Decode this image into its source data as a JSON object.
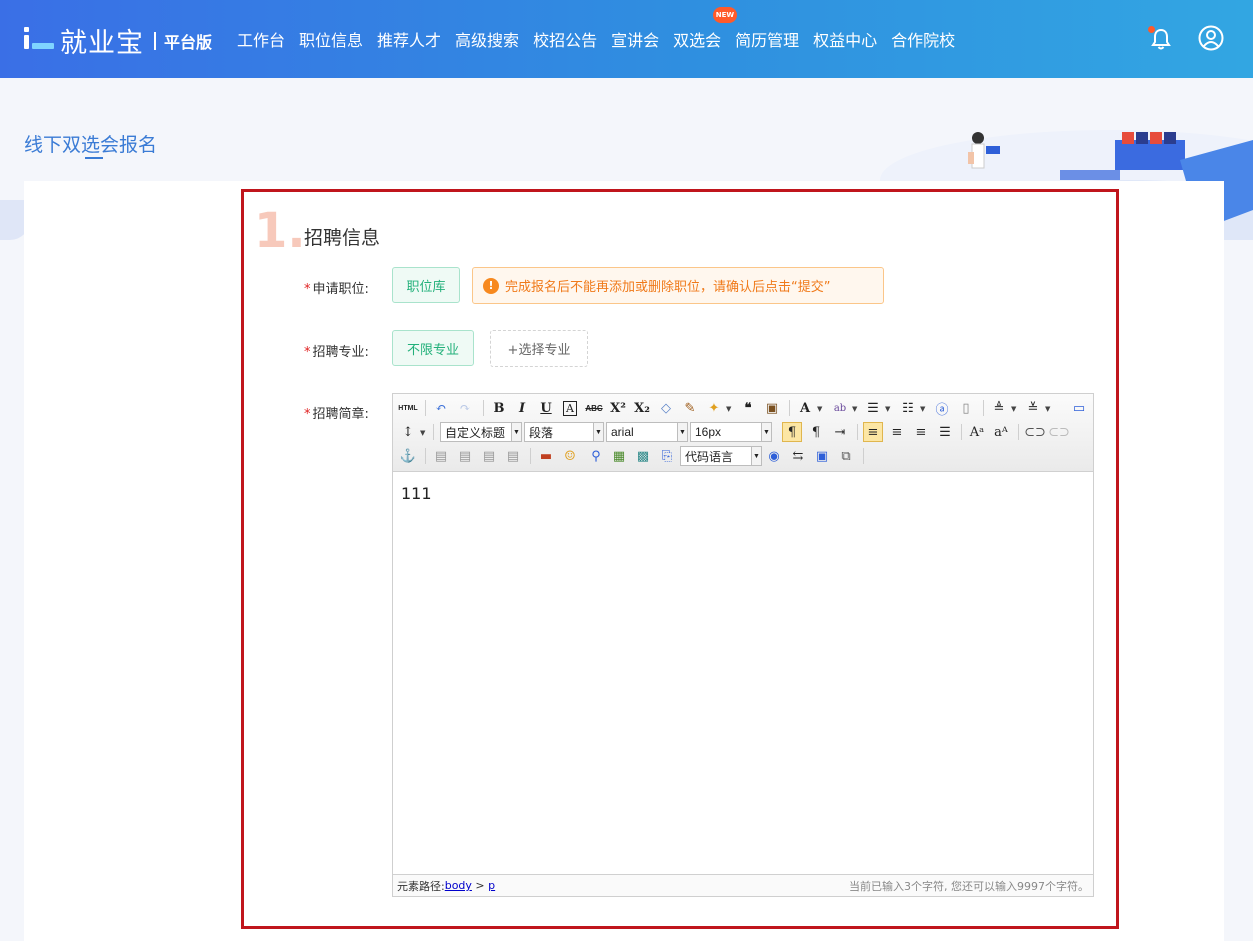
{
  "header": {
    "brand": "就业宝",
    "brand_sub": "平台版",
    "nav": [
      "工作台",
      "职位信息",
      "推荐人才",
      "高级搜索",
      "校招公告",
      "宣讲会",
      "双选会",
      "简历管理",
      "权益中心",
      "合作院校"
    ],
    "new_badge": "NEW",
    "colors": {
      "bar_start": "#3a6fe6",
      "bar_end": "#32a6e2",
      "badge": "#ff5a2a"
    }
  },
  "page": {
    "title": "线下双选会报名"
  },
  "section": {
    "step": "1.",
    "title": "招聘信息"
  },
  "form": {
    "position_label": "申请职位:",
    "position_tag": "职位库",
    "position_warning": "完成报名后不能再添加或删除职位，请确认后点击“提交”",
    "major_label": "招聘专业:",
    "major_tag": "不限专业",
    "major_add": "+选择专业",
    "brief_label": "招聘简章:",
    "required_mark": "*"
  },
  "editor": {
    "toolbar": {
      "html_btn": "HTML",
      "heading_select": "自定义标题",
      "paragraph_select": "段落",
      "font_select": "arial",
      "size_select": "16px",
      "code_select": "代码语言"
    },
    "content": "111",
    "status": {
      "path_label": "元素路径: ",
      "path_body": "body",
      "path_sep": " > ",
      "path_p": "p",
      "char_count": "当前已输入3个字符, 您还可以输入9997个字符。"
    }
  }
}
